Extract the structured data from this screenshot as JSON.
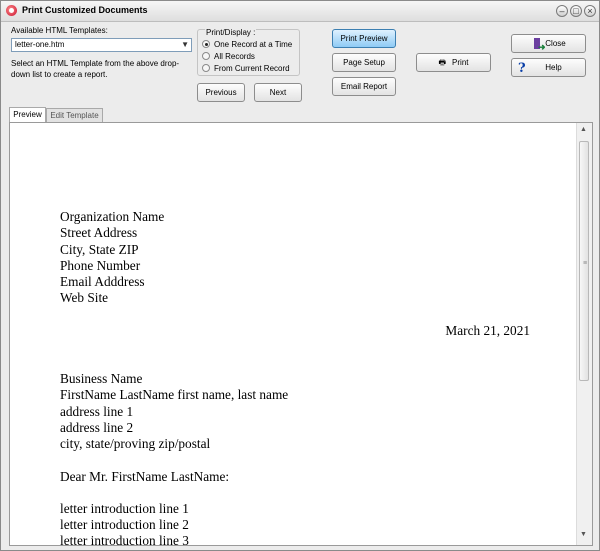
{
  "window": {
    "title": "Print Customized Documents"
  },
  "templates": {
    "label": "Available HTML Templates:",
    "selected": "letter-one.htm",
    "hint": "Select an HTML Template from the above drop-down list to create a report."
  },
  "print_display": {
    "title": "Print/Display :",
    "options": [
      "One Record at a Time",
      "All Records",
      "From Current Record"
    ]
  },
  "buttons": {
    "previous": "Previous",
    "next": "Next",
    "print_preview": "Print Preview",
    "page_setup": "Page Setup",
    "email_report": "Email Report",
    "print": "Print",
    "close": "Close",
    "help": "Help"
  },
  "tabs": [
    "Preview",
    "Edit Template"
  ],
  "letter": {
    "org": [
      "Organization Name",
      "Street Address",
      "City, State ZIP",
      "Phone Number",
      "Email Adddress",
      "Web Site"
    ],
    "date": "March 21, 2021",
    "recipient": [
      "Business Name",
      "FirstName LastName first name, last name",
      "address line 1",
      "address line 2",
      "city, state/proving zip/postal"
    ],
    "salutation": "Dear Mr. FirstName LastName:",
    "intro": [
      "letter introduction line 1",
      "letter introduction line 2",
      "letter introduction line 3"
    ]
  }
}
